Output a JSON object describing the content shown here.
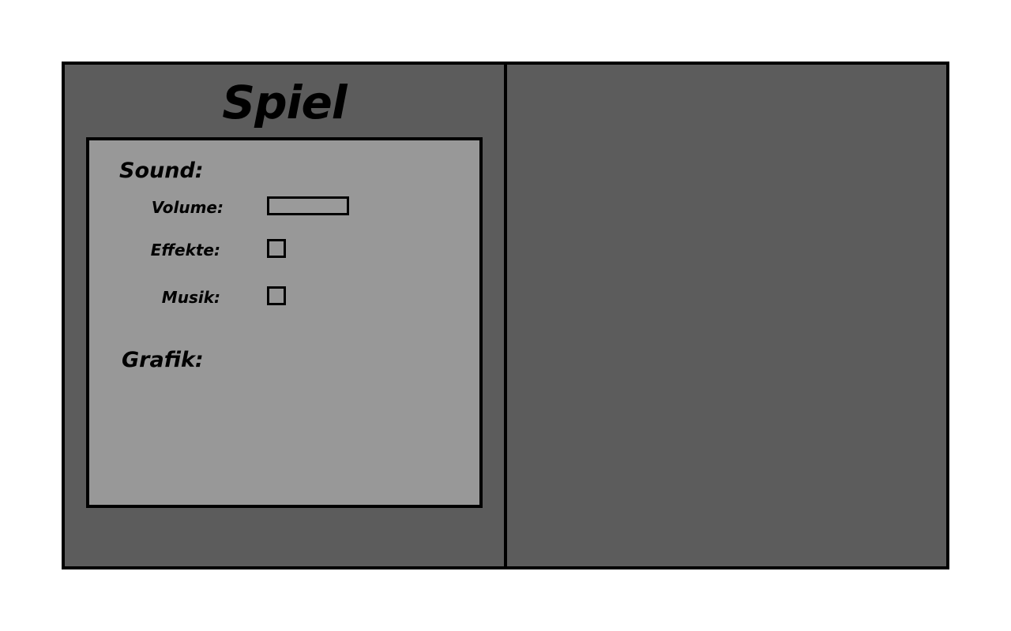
{
  "menu": {
    "title": "Spiel"
  },
  "sound": {
    "heading": "Sound:",
    "volume_label": "Volume:",
    "volume_level": 0,
    "effekte_label": "Effekte:",
    "effekte_checked": false,
    "musik_label": "Musik:",
    "musik_checked": false
  },
  "grafik": {
    "heading": "Grafik:"
  },
  "colors": {
    "frame_bg": "#5c5c5c",
    "settings_bg": "#989898",
    "border": "#000000"
  }
}
